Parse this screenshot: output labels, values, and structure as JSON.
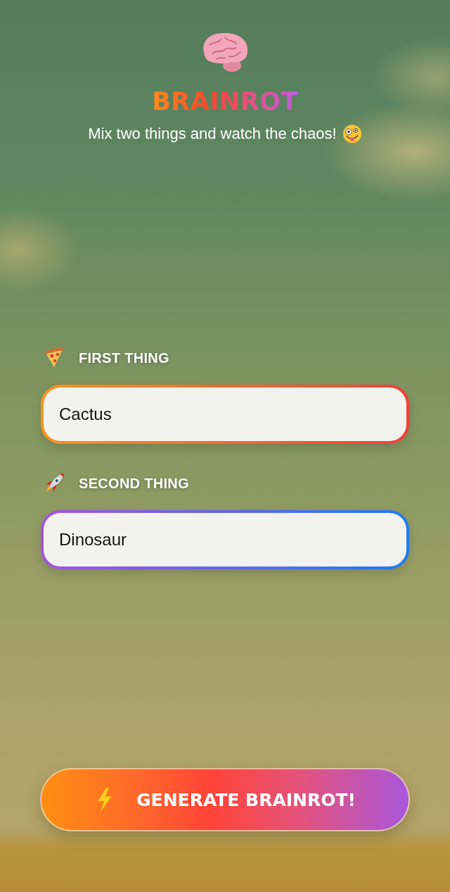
{
  "header": {
    "title": "BRAINROT",
    "subtitle": "Mix two things and watch the chaos!"
  },
  "inputs": [
    {
      "label": "FIRST THING",
      "value": "Cactus"
    },
    {
      "label": "SECOND THING",
      "value": "Dinosaur"
    }
  ],
  "generate_button": {
    "label": "GENERATE BRAINROT!"
  }
}
